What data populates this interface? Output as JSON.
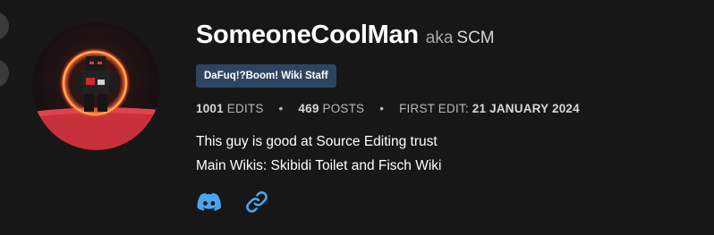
{
  "profile": {
    "username": "SomeoneCoolMan",
    "aka_prefix": "aka",
    "aka_name": "SCM",
    "badge": "DaFuq!?Boom! Wiki Staff",
    "stats": {
      "edits_value": "1001",
      "edits_label": "EDITS",
      "posts_value": "469",
      "posts_label": "POSTS",
      "first_edit_label": "FIRST EDIT:",
      "first_edit_value": "21 JANUARY 2024",
      "separator": "•"
    },
    "bio": [
      "This guy is good at Source Editing trust",
      "Main Wikis: Skibidi Toilet and Fisch Wiki"
    ],
    "socials": [
      {
        "icon": "discord-icon"
      },
      {
        "icon": "link-icon"
      }
    ]
  },
  "colors": {
    "background": "#171717",
    "badge_bg": "#2e4562",
    "icon_accent": "#4ba4f0",
    "avatar_ring": "#c9303a"
  }
}
